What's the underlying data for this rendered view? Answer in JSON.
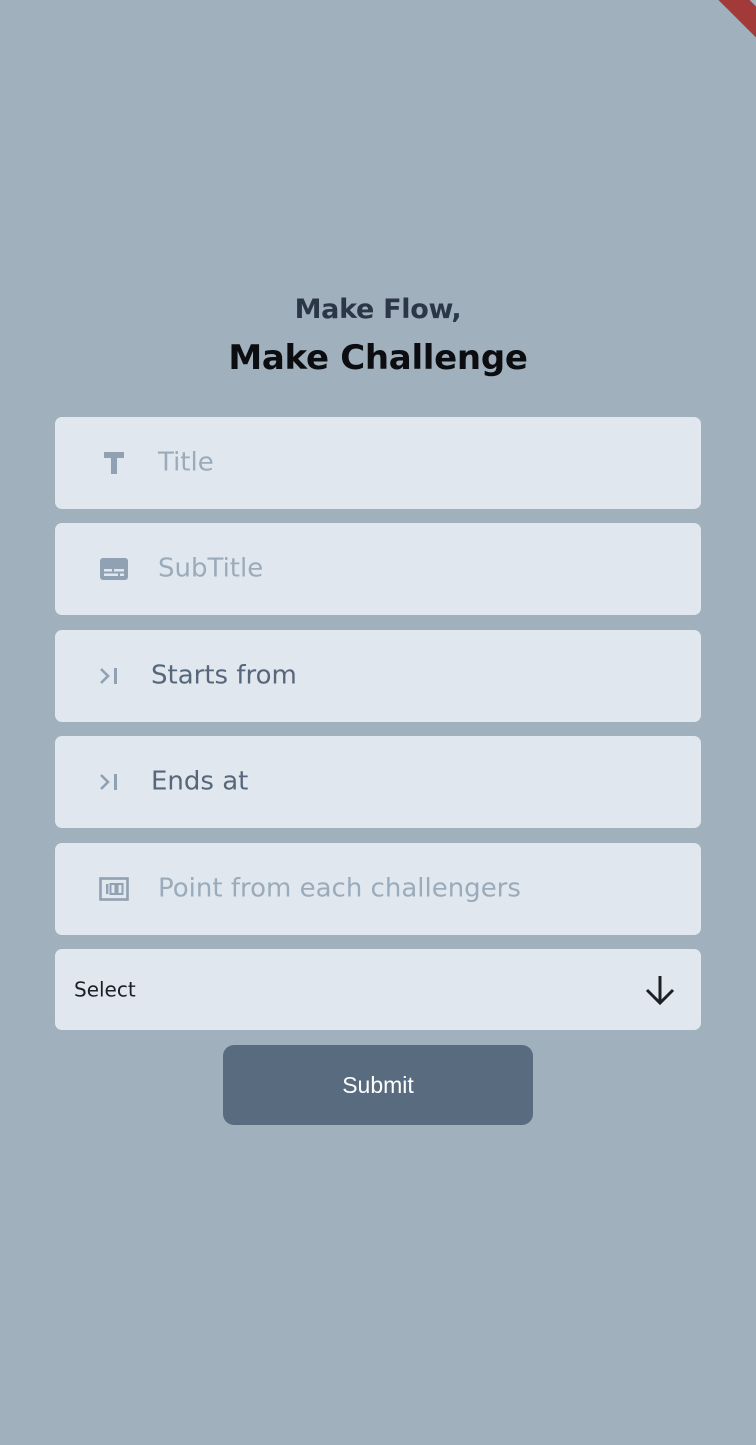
{
  "header": {
    "subtitle": "Make Flow,",
    "title": "Make Challenge"
  },
  "form": {
    "title_field": {
      "placeholder": "Title",
      "icon": "title-icon"
    },
    "subtitle_field": {
      "placeholder": "SubTitle",
      "icon": "subtitles-icon"
    },
    "starts_field": {
      "value": "Starts from",
      "icon": "skip-next-icon"
    },
    "ends_field": {
      "value": "Ends at",
      "icon": "skip-next-icon"
    },
    "points_field": {
      "placeholder": "Point from each challengers",
      "icon": "counter-100-icon"
    },
    "select": {
      "label": "Select",
      "icon": "arrow-down-icon"
    },
    "submit_label": "Submit"
  },
  "colors": {
    "background": "#a1b0bd",
    "field_background": "#e1e7ee",
    "button_background": "#596b7e",
    "debug_ribbon": "#a33a3a"
  }
}
